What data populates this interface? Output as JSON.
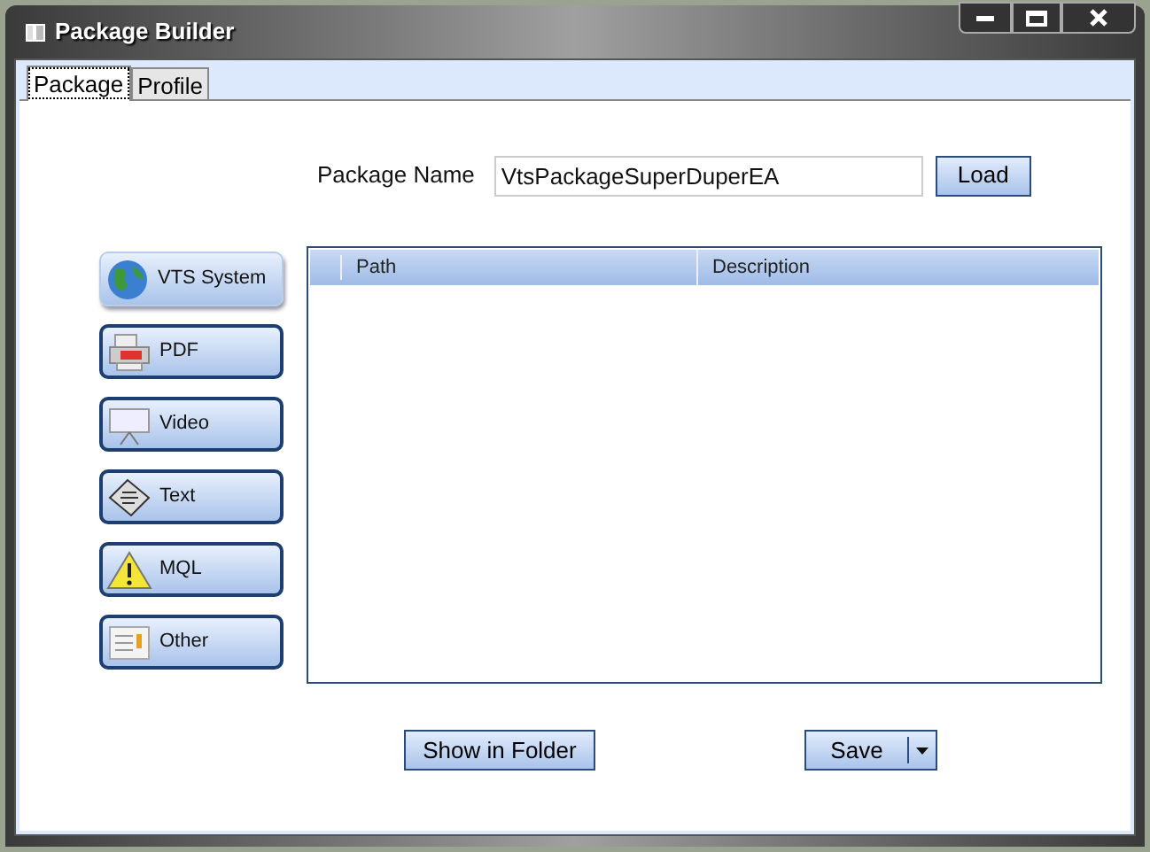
{
  "window": {
    "title": "Package Builder"
  },
  "tabs": [
    {
      "label": "Package",
      "selected": true
    },
    {
      "label": "Profile",
      "selected": false
    }
  ],
  "package_name": {
    "label": "Package Name",
    "value": "VtsPackageSuperDuperEA",
    "load_button": "Load"
  },
  "categories": [
    {
      "label": "VTS System",
      "kind": "globe",
      "selected": true
    },
    {
      "label": "PDF",
      "kind": "pdf",
      "selected": false
    },
    {
      "label": "Video",
      "kind": "screen",
      "selected": false
    },
    {
      "label": "Text",
      "kind": "text",
      "selected": false
    },
    {
      "label": "MQL",
      "kind": "warning",
      "selected": false
    },
    {
      "label": "Other",
      "kind": "other",
      "selected": false
    }
  ],
  "table": {
    "columns": [
      "Path",
      "Description"
    ]
  },
  "buttons": {
    "show_in_folder": "Show in Folder",
    "save": "Save"
  }
}
